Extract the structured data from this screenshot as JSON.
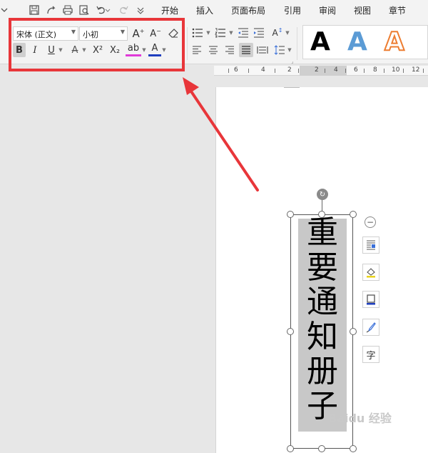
{
  "menu": {
    "tabs": [
      "开始",
      "插入",
      "页面布局",
      "引用",
      "审阅",
      "视图",
      "章节"
    ]
  },
  "ribbon": {
    "font_name": "宋体 (正文)",
    "font_size": "小初",
    "bold": "B",
    "italic": "I",
    "underline": "U",
    "font_color": "A",
    "superscript": "X²",
    "subscript": "X₂",
    "highlight": "ab",
    "text_color": "A",
    "grow_font": "A⁺",
    "shrink_font": "A⁻"
  },
  "styles": {
    "letters": [
      "A",
      "A",
      "A"
    ],
    "colors": [
      "#000000",
      "#5b9bd5",
      "#ed7d31"
    ]
  },
  "ruler": {
    "labels": [
      "6",
      "4",
      "2",
      "2",
      "4",
      "6",
      "8",
      "10",
      "12"
    ]
  },
  "document": {
    "vertical_text": [
      "重",
      "要",
      "通",
      "知",
      "册",
      "子"
    ]
  },
  "side_toolbar": {
    "text_btn": "字"
  },
  "watermark": "Baidu 经验",
  "colors": {
    "highlight_box": "#e8363a",
    "arrow": "#e8363a"
  }
}
